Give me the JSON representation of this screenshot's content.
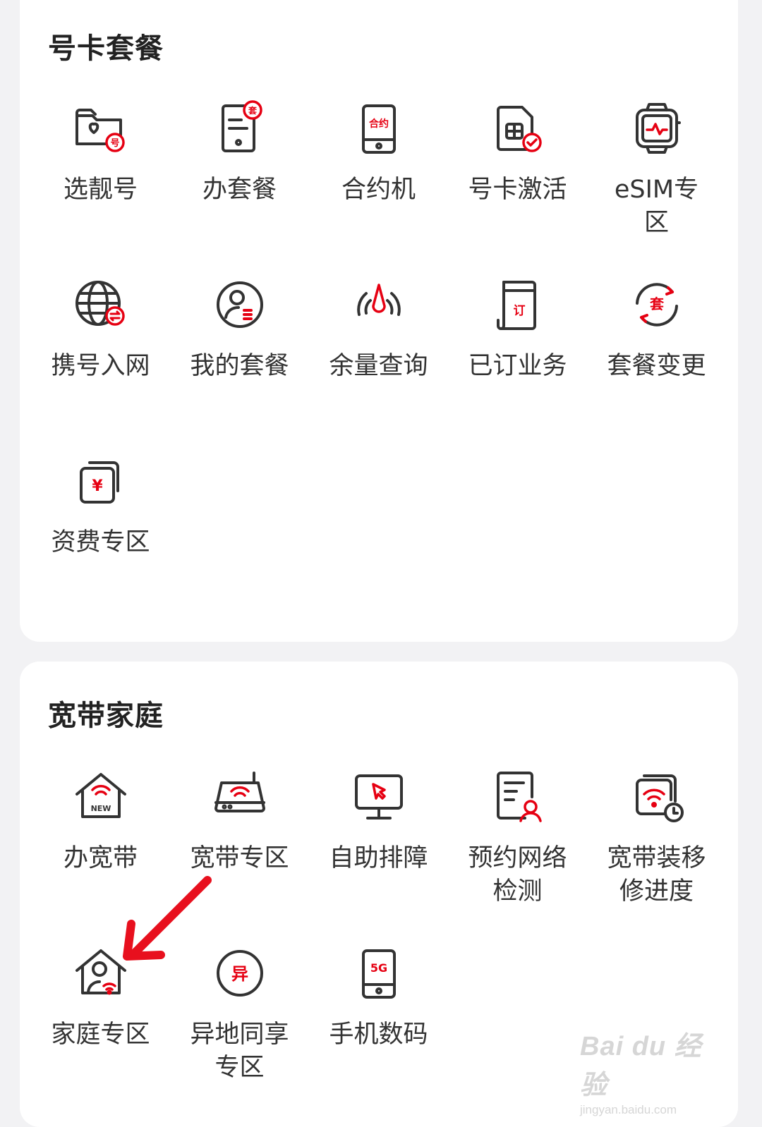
{
  "sections": [
    {
      "title": "号卡套餐",
      "items": [
        {
          "label": "选靓号",
          "icon": "folder-heart-number-icon"
        },
        {
          "label": "办套餐",
          "icon": "document-package-icon"
        },
        {
          "label": "合约机",
          "icon": "phone-contract-icon"
        },
        {
          "label": "号卡激活",
          "icon": "sim-card-check-icon"
        },
        {
          "label": "eSIM专区",
          "icon": "smartwatch-icon"
        },
        {
          "label": "携号入网",
          "icon": "globe-transfer-icon"
        },
        {
          "label": "我的套餐",
          "icon": "user-plan-icon"
        },
        {
          "label": "余量查询",
          "icon": "signal-gauge-icon"
        },
        {
          "label": "已订业务",
          "icon": "subscribed-document-icon"
        },
        {
          "label": "套餐变更",
          "icon": "package-refresh-icon"
        },
        {
          "label": "资费专区",
          "icon": "tariff-yuan-icon"
        }
      ]
    },
    {
      "title": "宽带家庭",
      "items": [
        {
          "label": "办宽带",
          "icon": "home-wifi-new-icon"
        },
        {
          "label": "宽带专区",
          "icon": "router-icon"
        },
        {
          "label": "自助排障",
          "icon": "monitor-cursor-icon"
        },
        {
          "label": "预约网络检测",
          "icon": "document-inspect-icon"
        },
        {
          "label": "宽带装移修进度",
          "icon": "wifi-progress-clock-icon"
        },
        {
          "label": "家庭专区",
          "icon": "home-user-icon"
        },
        {
          "label": "异地同享专区",
          "icon": "circle-yi-icon"
        },
        {
          "label": "手机数码",
          "icon": "phone-5g-icon"
        }
      ]
    }
  ],
  "icon_text": {
    "hao": "号",
    "tao": "套",
    "heyue": "合约",
    "ding": "订",
    "yuan": "¥",
    "new": "NEW",
    "yi": "异",
    "fiveg": "5G"
  },
  "colors": {
    "accent": "#e60012",
    "stroke": "#333333",
    "text": "#333333",
    "background": "#f2f2f4",
    "card": "#ffffff"
  },
  "watermark": {
    "main": "Bai du 经验",
    "sub": "jingyan.baidu.com"
  }
}
